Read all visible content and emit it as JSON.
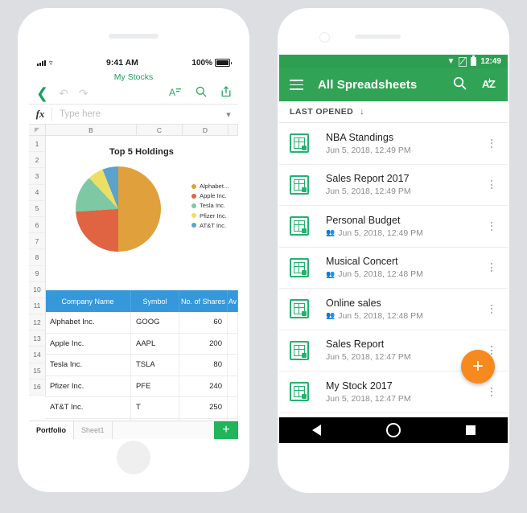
{
  "left_phone": {
    "device": "iphone",
    "status_bar": {
      "time": "9:41 AM",
      "battery_pct": "100%",
      "signal_icon": "cellular-signal-icon",
      "wifi_icon": "wifi-icon",
      "battery_icon": "battery-icon"
    },
    "doc_title": "My Stocks",
    "toolbar": {
      "back_icon": "chevron-left-icon",
      "undo_icon": "undo-icon",
      "redo_icon": "redo-icon",
      "format_icon": "text-format-icon",
      "search_icon": "search-icon",
      "share_icon": "share-icon"
    },
    "formula_bar": {
      "fx_label": "fx",
      "placeholder": "Type here",
      "value": "",
      "expand_icon": "chevron-down-icon"
    },
    "column_headers": [
      "",
      "B",
      "C",
      "D",
      ""
    ],
    "row_numbers": [
      "1",
      "2",
      "3",
      "4",
      "5",
      "6",
      "7",
      "8",
      "9",
      "10"
    ],
    "table": {
      "header_row_number": "11",
      "headers": [
        "Company Name",
        "Symbol",
        "No. of Shares",
        "Av"
      ],
      "rows": [
        {
          "row_number": "12",
          "company": "Alphabet Inc.",
          "symbol": "GOOG",
          "shares": "60",
          "avg": ""
        },
        {
          "row_number": "13",
          "company": "Apple Inc.",
          "symbol": "AAPL",
          "shares": "200",
          "avg": ""
        },
        {
          "row_number": "14",
          "company": "Tesla Inc.",
          "symbol": "TSLA",
          "shares": "80",
          "avg": ""
        },
        {
          "row_number": "15",
          "company": "Pfizer Inc.",
          "symbol": "PFE",
          "shares": "240",
          "avg": ""
        },
        {
          "row_number": "16",
          "company": "AT&T Inc.",
          "symbol": "T",
          "shares": "250",
          "avg": ""
        }
      ]
    },
    "sheet_tabs": {
      "active": "Portfolio",
      "inactive": "Sheet1",
      "add_label": "+"
    }
  },
  "chart_data": {
    "type": "pie",
    "title": "Top 5 Holdings",
    "labels": [
      "Alphabet...",
      "Apple Inc.",
      "Tesla Inc.",
      "Pfizer Inc.",
      "AT&T Inc."
    ],
    "values": [
      50,
      24,
      14,
      6,
      6
    ],
    "colors": [
      "#e0a03c",
      "#e06442",
      "#7fc8a4",
      "#ecdf63",
      "#5ba3cc"
    ],
    "legend_position": "right",
    "grid": false
  },
  "right_phone": {
    "device": "android",
    "status_bar": {
      "time": "12:49",
      "wifi_icon": "wifi-icon",
      "sim_icon": "no-sim-icon",
      "battery_icon": "battery-icon"
    },
    "app_bar": {
      "menu_icon": "hamburger-menu-icon",
      "title": "All Spreadsheets",
      "search_icon": "search-icon",
      "sort_icon": "sort-alphabetical-icon",
      "sort_label": "AZ",
      "background": "#31a354"
    },
    "sort_header": {
      "label": "LAST OPENED",
      "arrow_icon": "arrow-down-icon"
    },
    "files": [
      {
        "icon": "google-sheets-icon",
        "name": "NBA Standings",
        "date": "Jun 5, 2018, 12:49 PM",
        "shared": false,
        "menu_icon": "more-vert-icon"
      },
      {
        "icon": "google-sheets-icon",
        "name": "Sales Report 2017",
        "date": "Jun 5, 2018, 12:49 PM",
        "shared": false,
        "menu_icon": "more-vert-icon"
      },
      {
        "icon": "google-sheets-icon",
        "name": "Personal Budget",
        "date": "Jun 5, 2018, 12:49 PM",
        "shared": true,
        "menu_icon": "more-vert-icon"
      },
      {
        "icon": "google-sheets-icon",
        "name": "Musical Concert",
        "date": "Jun 5, 2018, 12:48 PM",
        "shared": true,
        "menu_icon": "more-vert-icon"
      },
      {
        "icon": "google-sheets-icon",
        "name": "Online sales",
        "date": "Jun 5, 2018, 12:48 PM",
        "shared": true,
        "menu_icon": "more-vert-icon"
      },
      {
        "icon": "google-sheets-icon",
        "name": "Sales Report",
        "date": "Jun 5, 2018, 12:47 PM",
        "shared": false,
        "menu_icon": "more-vert-icon"
      },
      {
        "icon": "google-sheets-icon",
        "name": "My Stock 2017",
        "date": "Jun 5, 2018, 12:47 PM",
        "shared": false,
        "menu_icon": "more-vert-icon"
      }
    ],
    "fab": {
      "label": "+",
      "icon": "plus-icon",
      "color": "#f68a1e"
    },
    "nav_bar": {
      "back_icon": "nav-back-icon",
      "home_icon": "nav-home-icon",
      "recents_icon": "nav-recents-icon"
    }
  },
  "colors": {
    "page_background": "#dcdee1",
    "sheets_green": "#21b55b",
    "android_green": "#31a354",
    "table_header_blue": "#3498db",
    "fab_orange": "#f68a1e"
  }
}
